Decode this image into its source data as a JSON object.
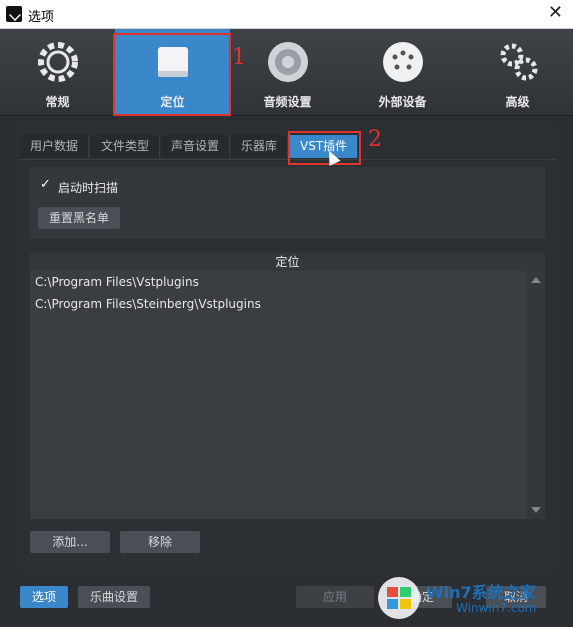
{
  "window": {
    "title": "选项",
    "close": "✕"
  },
  "categories": [
    {
      "label": "常规",
      "icon": "gear-cycle-icon"
    },
    {
      "label": "定位",
      "icon": "drive-icon"
    },
    {
      "label": "音频设置",
      "icon": "speaker-icon"
    },
    {
      "label": "外部设备",
      "icon": "socket-icon"
    },
    {
      "label": "高级",
      "icon": "gears-icon"
    }
  ],
  "annotations": {
    "one": "1",
    "two": "2"
  },
  "tabs": [
    "用户数据",
    "文件类型",
    "声音设置",
    "乐器库",
    "VST插件"
  ],
  "scan": {
    "checkbox_mark": "✓",
    "label": "启动时扫描",
    "reset_button": "重置黑名单"
  },
  "locations": {
    "title": "定位",
    "items": [
      "C:\\Program Files\\Vstplugins",
      "C:\\Program Files\\Steinberg\\Vstplugins"
    ],
    "add_button": "添加...",
    "remove_button": "移除"
  },
  "footer": {
    "options": "选项",
    "song_settings": "乐曲设置",
    "apply": "应用",
    "ok": "确定",
    "cancel": "取消"
  },
  "watermark": {
    "brand": "Win7系统之家",
    "url": "Winwin7.com"
  },
  "colors": {
    "accent": "#3a87c9",
    "annotation": "#e0342c"
  }
}
